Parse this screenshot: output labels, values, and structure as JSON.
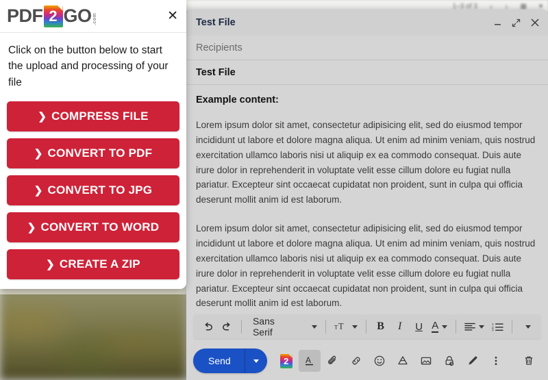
{
  "background": {
    "pagination": "1–3 of 3",
    "prev_icon": "chevron-left-icon",
    "next_icon": "chevron-right-icon",
    "keyboard_icon": "keyboard-icon",
    "dropdown_icon": "chevron-down-icon"
  },
  "pdf_popup": {
    "logo": {
      "part1": "PDF",
      "square": "2",
      "part2": "GO",
      "suffix": ".com"
    },
    "close_label": "✕",
    "message": "Click on the button below to start the upload and processing of your file",
    "accent_color": "#ce2238",
    "buttons": [
      {
        "chevron": "❯",
        "label": "COMPRESS FILE"
      },
      {
        "chevron": "❯",
        "label": "CONVERT TO PDF"
      },
      {
        "chevron": "❯",
        "label": "CONVERT TO JPG"
      },
      {
        "chevron": "❯",
        "label": "CONVERT TO WORD"
      },
      {
        "chevron": "❯",
        "label": "CREATE A ZIP"
      }
    ]
  },
  "compose": {
    "title": "Test File",
    "window_controls": {
      "minimize": "minimize-icon",
      "expand": "expand-icon",
      "close": "close-icon"
    },
    "recipients_placeholder": "Recipients",
    "subject": "Test File",
    "body": {
      "lead": "Example content:",
      "paragraphs": [
        "Lorem ipsum dolor sit amet, consectetur adipisicing elit, sed do eiusmod tempor incididunt ut labore et dolore magna aliqua. Ut enim ad minim veniam, quis nostrud exercitation ullamco laboris nisi ut aliquip ex ea commodo consequat. Duis aute irure dolor in reprehenderit in voluptate velit esse cillum dolore eu fugiat nulla pariatur. Excepteur sint occaecat cupidatat non proident, sunt in culpa qui officia deserunt mollit anim id est laborum.",
        "Lorem ipsum dolor sit amet, consectetur adipisicing elit, sed do eiusmod tempor incididunt ut labore et dolore magna aliqua. Ut enim ad minim veniam, quis nostrud exercitation ullamco laboris nisi ut aliquip ex ea commodo consequat. Duis aute irure dolor in reprehenderit in voluptate velit esse cillum dolore eu fugiat nulla pariatur. Excepteur sint occaecat cupidatat non proident, sunt in culpa qui officia deserunt mollit anim id est laborum."
      ]
    },
    "format_toolbar": {
      "undo": "undo-icon",
      "redo": "redo-icon",
      "font_name": "Sans Serif",
      "font_size": "text-size-icon",
      "bold": "B",
      "italic": "I",
      "underline": "U",
      "text_color": "A",
      "align": "align-left-icon",
      "list": "numbered-list-icon",
      "more": "more-formatting-icon"
    },
    "send_bar": {
      "send_label": "Send",
      "send_color": "#1a51c4",
      "send_dropdown": "chevron-down-icon",
      "pdf2go_addon": "2",
      "format_options": "format-A-icon",
      "attach": "paperclip-icon",
      "link": "link-icon",
      "emoji": "emoji-icon",
      "drive": "google-drive-icon",
      "image": "insert-photo-icon",
      "confidential": "confidential-lock-icon",
      "signature": "signature-pen-icon",
      "more_options": "more-vertical-icon",
      "discard": "trash-icon"
    }
  }
}
